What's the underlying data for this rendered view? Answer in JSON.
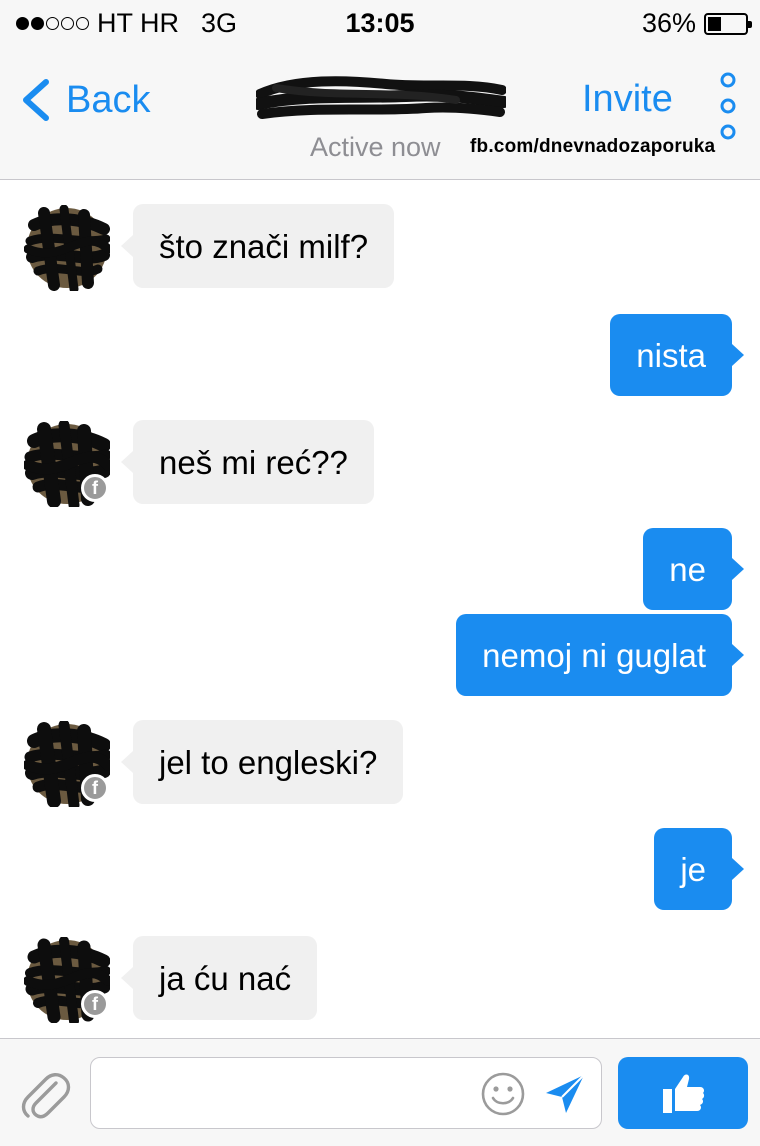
{
  "status_bar": {
    "carrier": "HT HR",
    "network": "3G",
    "time": "13:05",
    "battery": "36%",
    "battery_level": 0.36,
    "signal_bars": 2
  },
  "nav": {
    "back_label": "Back",
    "contact_name": "",
    "active_status": "Active now",
    "watermark": "fb.com/dnevnadozaporuka",
    "invite_label": "Invite"
  },
  "messages": [
    {
      "direction": "in",
      "text": "što znači milf?",
      "avatar": true,
      "fb_badge": false
    },
    {
      "direction": "out",
      "text": "nista"
    },
    {
      "direction": "in",
      "text": "neš mi reć??",
      "avatar": true,
      "fb_badge": true
    },
    {
      "direction": "out",
      "text": "ne"
    },
    {
      "direction": "out",
      "text": "nemoj ni guglat"
    },
    {
      "direction": "in",
      "text": "jel to engleski?",
      "avatar": true,
      "fb_badge": true
    },
    {
      "direction": "out",
      "text": "je"
    },
    {
      "direction": "in",
      "text": "ja ću nać",
      "avatar": true,
      "fb_badge": true
    }
  ],
  "composer": {
    "input_value": "",
    "placeholder": ""
  },
  "colors": {
    "accent": "#1a8cf0",
    "incoming_bubble": "#f0f0f0",
    "bar_background": "#f7f7f7"
  },
  "icons": {
    "back": "chevron-left-icon",
    "more": "vertical-dots-icon",
    "attach": "paperclip-icon",
    "emoji": "smiley-icon",
    "send": "paper-plane-icon",
    "like": "thumbs-up-icon",
    "fb_badge": "facebook-icon"
  }
}
